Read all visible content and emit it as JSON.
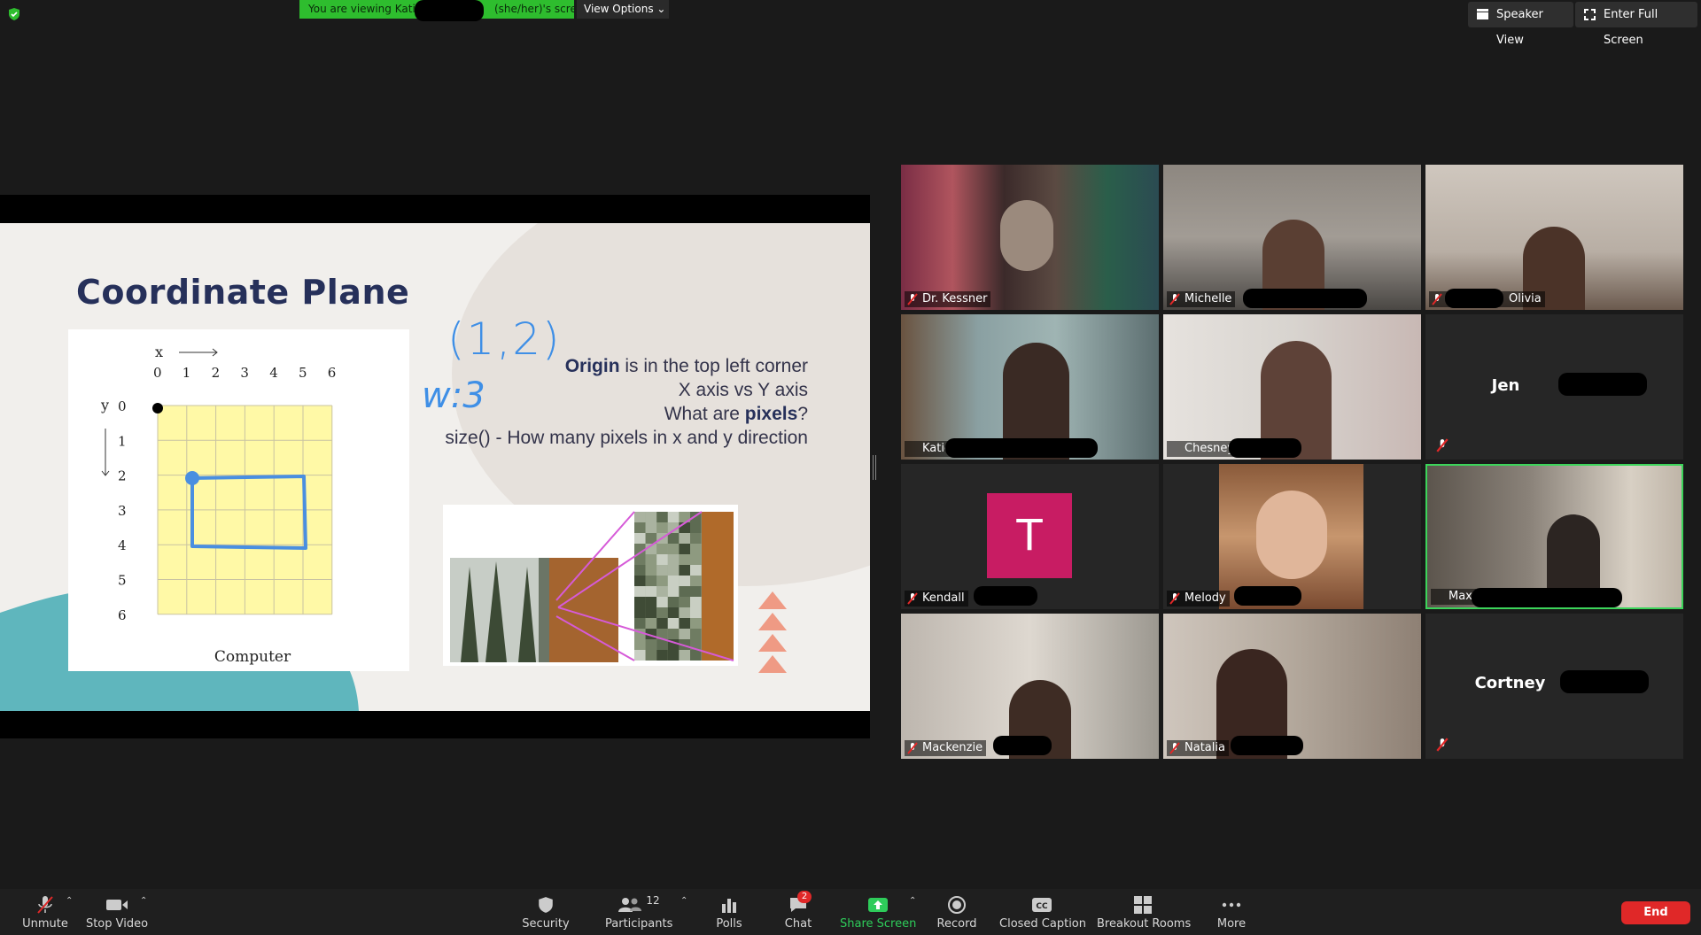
{
  "banner": {
    "viewing_text": "You are viewing Katie ",
    "viewing_suffix": "(she/her)'s screen",
    "view_options": "View Options"
  },
  "top_right": {
    "speaker_view": "Speaker View",
    "full_screen": "Enter Full Screen"
  },
  "slide": {
    "title": "Coordinate Plane",
    "grid": {
      "x_label": "x",
      "y_label": "y",
      "x_ticks": [
        "0",
        "1",
        "2",
        "3",
        "4",
        "5",
        "6"
      ],
      "y_ticks": [
        "0",
        "1",
        "2",
        "3",
        "4",
        "5",
        "6"
      ],
      "caption": "Computer"
    },
    "handwriting": {
      "coords": "(1,2)",
      "w": "w:3"
    },
    "bullets": {
      "line1_bold": "Origin",
      "line1_rest": " is in the top left corner",
      "line2": "X axis vs Y axis",
      "line3_pre": "What are ",
      "line3_bold": "pixels",
      "line3_post": "?",
      "line4": "size() - How many pixels in x and y direction"
    }
  },
  "participants": [
    {
      "name": "Dr. Kessner"
    },
    {
      "name": "Michelle"
    },
    {
      "name": "Olivia"
    },
    {
      "name": "Katie"
    },
    {
      "name": "Chesney"
    },
    {
      "name": "Jen"
    },
    {
      "name": "Kendall",
      "initial": "T"
    },
    {
      "name": "Melody"
    },
    {
      "name": "Max"
    },
    {
      "name": "Mackenzie"
    },
    {
      "name": "Natalia"
    },
    {
      "name": "Cortney"
    }
  ],
  "toolbar": {
    "unmute": "Unmute",
    "stop_video": "Stop Video",
    "security": "Security",
    "participants": "Participants",
    "participants_count": "12",
    "polls": "Polls",
    "chat": "Chat",
    "chat_badge": "2",
    "share_screen": "Share Screen",
    "record": "Record",
    "closed_caption": "Closed Caption",
    "breakout_rooms": "Breakout Rooms",
    "more": "More",
    "end": "End"
  },
  "colors": {
    "banner_green": "#2ebd2e",
    "active_speaker": "#3cd45a",
    "end_red": "#e02828",
    "kendall_avatar": "#c81c63",
    "slide_navy": "#26305a"
  }
}
